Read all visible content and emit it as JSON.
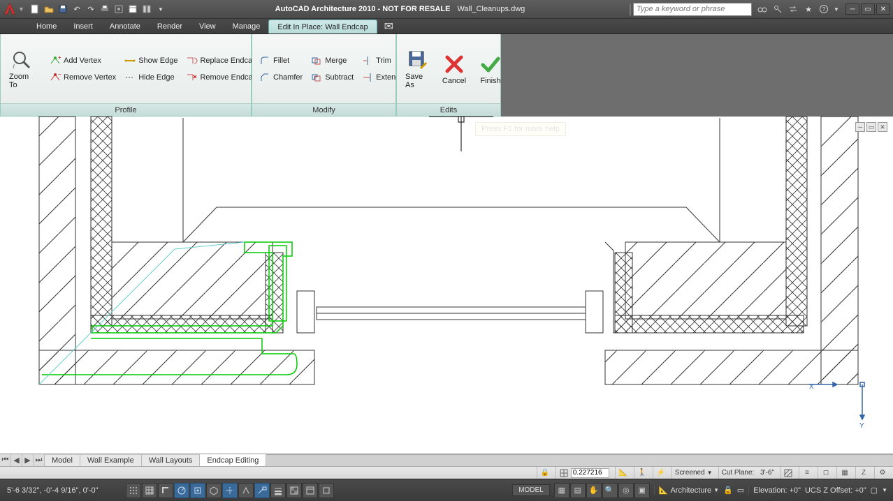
{
  "title": {
    "app": "AutoCAD Architecture 2010 - NOT FOR RESALE",
    "file": "Wall_Cleanups.dwg"
  },
  "search": {
    "placeholder": "Type a keyword or phrase"
  },
  "menus": {
    "home": "Home",
    "insert": "Insert",
    "annotate": "Annotate",
    "render": "Render",
    "view": "View",
    "manage": "Manage",
    "edit_in_place": "Edit In Place: Wall Endcap"
  },
  "ribbon": {
    "zoom_to": "Zoom To",
    "add_vertex": "Add Vertex",
    "remove_vertex": "Remove Vertex",
    "show_edge": "Show Edge",
    "hide_edge": "Hide Edge",
    "replace_endcap": "Replace Endcap",
    "remove_endcap": "Remove Endcap",
    "fillet": "Fillet",
    "chamfer": "Chamfer",
    "merge": "Merge",
    "subtract": "Subtract",
    "trim": "Trim",
    "extend": "Extend",
    "save_as": "Save As",
    "cancel": "Cancel",
    "finish": "Finish",
    "panel_profile": "Profile",
    "panel_modify": "Modify",
    "panel_edits": "Edits"
  },
  "tooltip": "Press F1 for more help",
  "layout_tabs": {
    "model": "Model",
    "wall_example": "Wall Example",
    "wall_layouts": "Wall Layouts",
    "endcap_editing": "Endcap Editing"
  },
  "status": {
    "scale_val": "0.227216",
    "screened": "Screened",
    "cut_plane_label": "Cut Plane:",
    "cut_plane_val": "3'-6\"",
    "elevation_label": "Elevation:",
    "elevation_val": "+0\"",
    "arch": "Architecture",
    "ucs_label": "UCS Z Offset:",
    "ucs_val": "+0\""
  },
  "bottom": {
    "coords": "5'-6 3/32\",  -0'-4 9/16\",  0'-0\"",
    "model_btn": "MODEL"
  }
}
